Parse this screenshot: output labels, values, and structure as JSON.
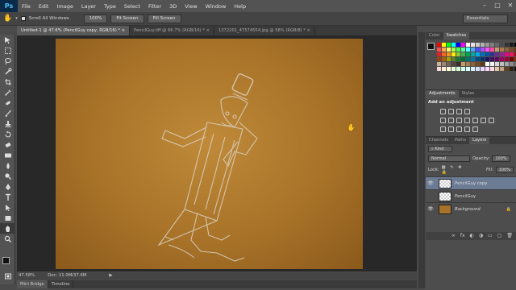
{
  "app": {
    "logo": "Ps"
  },
  "menu": [
    "File",
    "Edit",
    "Image",
    "Layer",
    "Type",
    "Select",
    "Filter",
    "3D",
    "View",
    "Window",
    "Help"
  ],
  "window_controls": [
    "–",
    "□",
    "✕"
  ],
  "options": {
    "scroll_all_windows": "Scroll All Windows",
    "btn_100": "100%",
    "fit_screen": "Fit Screen",
    "fill_screen": "Fill Screen",
    "workspace": "Essentials"
  },
  "doc_tabs": [
    "Untitled-1 @ 47.6% (PencilGuy copy, RGB/16) * ×",
    "PencilGuy.tiff @ 66.7% (RGB/16) * ×",
    "1372201_47574554.jpg @ 58% (RGB/8) * ×"
  ],
  "status": {
    "zoom": "47.58%",
    "doc": "Doc: 11.0M/37.6M"
  },
  "bottom_tabs": [
    "Mini Bridge",
    "Timeline"
  ],
  "color_panel": {
    "tabs": [
      "Color",
      "Swatches"
    ]
  },
  "swatch_colors": [
    "#ff0000",
    "#ffff00",
    "#00ff00",
    "#00ffff",
    "#0000ff",
    "#ff00ff",
    "#ffffff",
    "#e6e6e6",
    "#cccccc",
    "#b3b3b3",
    "#999999",
    "#808080",
    "#666666",
    "#4d4d4d",
    "#333333",
    "#1a1a1a",
    "#000000",
    "#ff4d4d",
    "#ffa64d",
    "#ffff66",
    "#a6ff4d",
    "#4dff4d",
    "#4dffa6",
    "#4dffff",
    "#4da6ff",
    "#4d4dff",
    "#a64dff",
    "#ff4dff",
    "#ff4da6",
    "#c69c6d",
    "#a67c52",
    "#8c6239",
    "#754c24",
    "#603813",
    "#ed1c24",
    "#f26522",
    "#f7941d",
    "#fff200",
    "#8dc63f",
    "#39b54a",
    "#00a651",
    "#00a99d",
    "#00aeef",
    "#0072bc",
    "#0054a6",
    "#2e3192",
    "#662d91",
    "#92278f",
    "#ec008c",
    "#ed145b",
    "#9e0b0f",
    "#a0410d",
    "#a36209",
    "#aba000",
    "#598527",
    "#1a7b30",
    "#007236",
    "#00746b",
    "#0076a3",
    "#004b80",
    "#003471",
    "#1b1464",
    "#440e62",
    "#630460",
    "#9e005d",
    "#9e0039",
    "#790000",
    "#7b2e00",
    "#c7b299",
    "#998675",
    "#736357",
    "#534741",
    "#37302a",
    "#c69c6d",
    "#a67c52",
    "#8c6239",
    "#754c24",
    "#603813",
    "#ffffff",
    "#f2f2f2",
    "#d9d9d9",
    "#bfbfbf",
    "#a6a6a6",
    "#8c8c8c",
    "#737373",
    "#ffd8d8",
    "#fff0d8",
    "#ffffd8",
    "#e8ffd8",
    "#d8ffd8",
    "#d8fff0",
    "#d8ffff",
    "#d8f0ff",
    "#d8e0ff",
    "#e8d8ff",
    "#ffd8ff",
    "#ffd8e8",
    "#e0c8a8",
    "#c0a080",
    "#604020",
    "#302010",
    "#101010"
  ],
  "adjustments": {
    "tabs": [
      "Adjustments",
      "Styles"
    ],
    "title": "Add an adjustment"
  },
  "layers_panel": {
    "tabs": [
      "Channels",
      "Paths",
      "Layers"
    ],
    "kind": "⌕ Kind",
    "blend": "Normal",
    "opacity_label": "Opacity:",
    "opacity": "100%",
    "lock_label": "Lock:",
    "fill_label": "Fill:",
    "fill": "100%",
    "layers": [
      {
        "name": "PencilGuy copy",
        "visible": true,
        "selected": true
      },
      {
        "name": "PencilGuy",
        "visible": false,
        "selected": false
      },
      {
        "name": "Background",
        "visible": true,
        "selected": false
      }
    ],
    "footer_icons": [
      "∞",
      "fx",
      "◐",
      "◑",
      "▭",
      "▢",
      "🗑"
    ]
  }
}
